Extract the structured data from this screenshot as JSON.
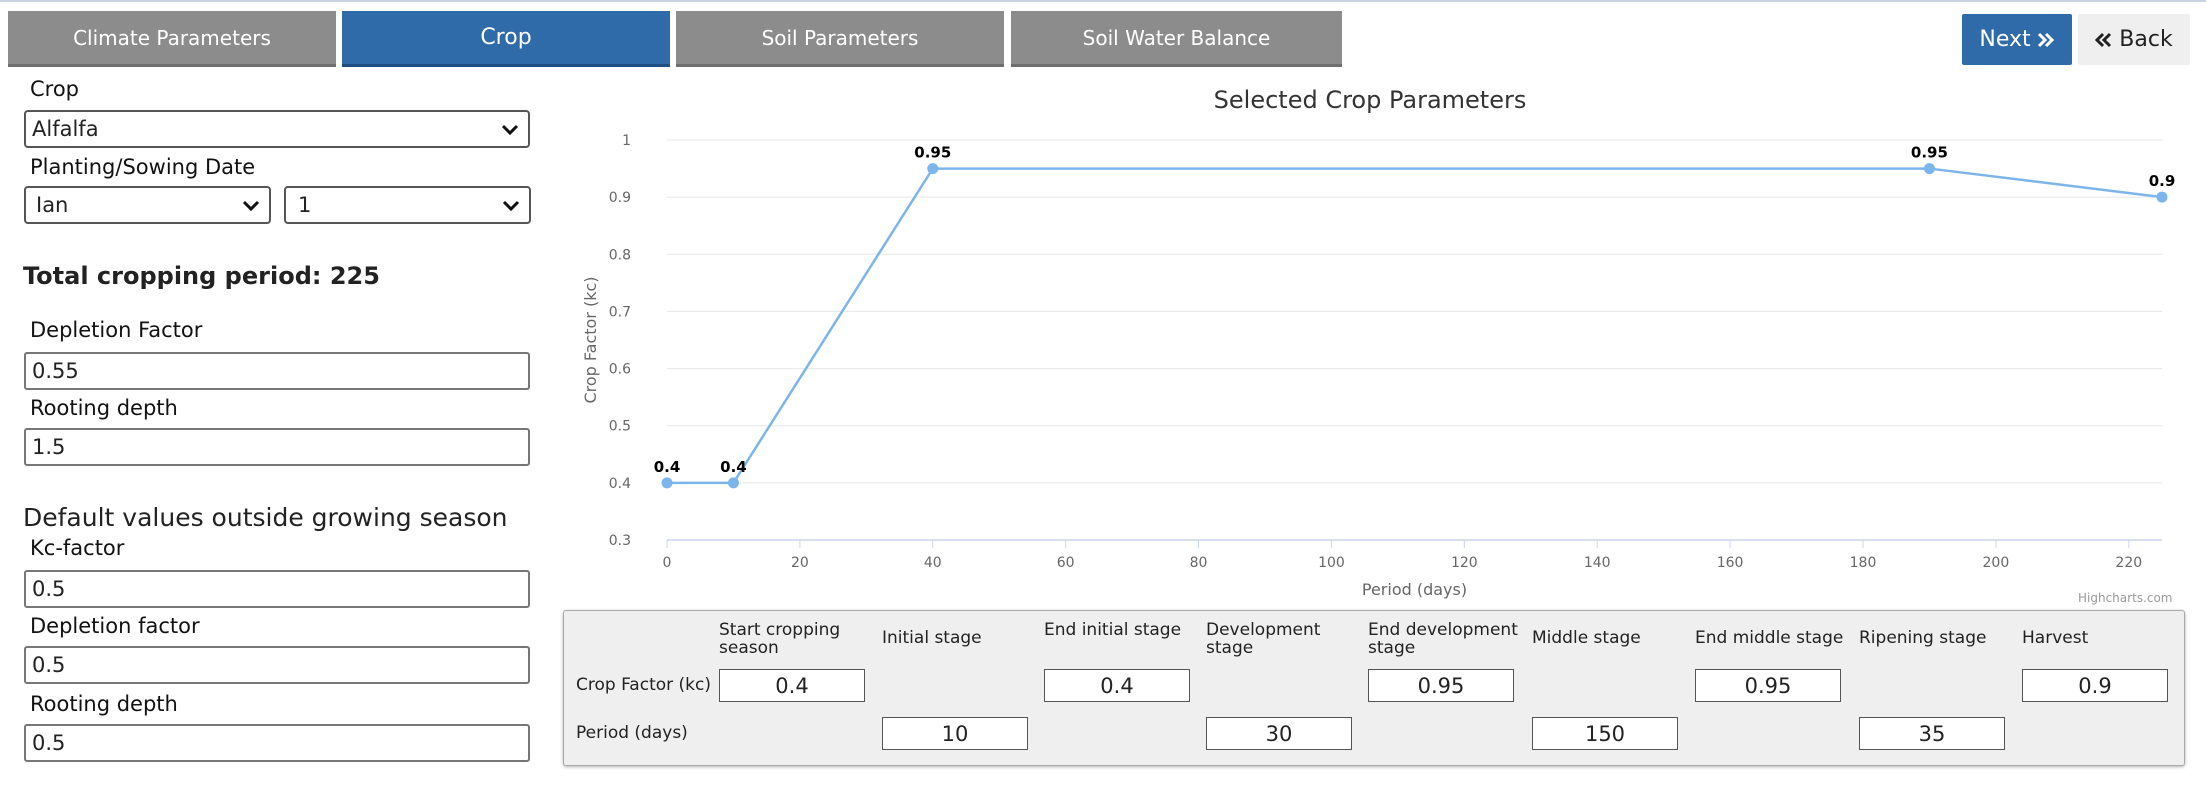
{
  "tabs": [
    {
      "label": "Climate Parameters",
      "active": false
    },
    {
      "label": "Crop",
      "active": true
    },
    {
      "label": "Soil Parameters",
      "active": false
    },
    {
      "label": "Soil Water Balance",
      "active": false
    }
  ],
  "nav": {
    "next_label": "Next",
    "next_icon": "double-chevron-right-icon",
    "back_label": "Back",
    "back_icon": "double-chevron-left-icon"
  },
  "form": {
    "crop_label": "Crop",
    "crop_value": "Alfalfa",
    "planting_label": "Planting/Sowing Date",
    "month_value": "Ian",
    "day_value": "1",
    "total_period_text": "Total cropping period: 225",
    "depletion_label": "Depletion Factor",
    "depletion_value": "0.55",
    "rooting_label": "Rooting depth",
    "rooting_value": "1.5",
    "defaults_heading": "Default values outside growing season",
    "kc_label": "Kc-factor",
    "kc_value": "0.5",
    "default_depletion_label": "Depletion factor",
    "default_depletion_value": "0.5",
    "default_rooting_label": "Rooting depth",
    "default_rooting_value": "0.5"
  },
  "chart_data": {
    "type": "line",
    "title": "Selected Crop Parameters",
    "xlabel": "Period (days)",
    "ylabel": "Crop Factor (kc)",
    "x": [
      0,
      10,
      40,
      190,
      225
    ],
    "series": [
      {
        "values": [
          0.4,
          0.4,
          0.95,
          0.95,
          0.9
        ]
      }
    ],
    "data_labels": [
      "0.4",
      "0.4",
      "0.95",
      "0.95",
      "0.9"
    ],
    "xlim": [
      0,
      225
    ],
    "ylim": [
      0.3,
      1
    ],
    "xticks": [
      "0",
      "20",
      "40",
      "60",
      "80",
      "100",
      "120",
      "140",
      "160",
      "180",
      "200",
      "220"
    ],
    "yticks": [
      "0.3",
      "0.4",
      "0.5",
      "0.6",
      "0.7",
      "0.8",
      "0.9",
      "1"
    ],
    "grid": true,
    "line_color": "#7cb5ec",
    "credits": "Highcharts.com"
  },
  "table": {
    "columns": [
      "Start cropping season",
      "Initial stage",
      "End initial stage",
      "Development stage",
      "End development stage",
      "Middle stage",
      "End middle stage",
      "Ripening stage",
      "Harvest"
    ],
    "rows": [
      {
        "label": "Crop Factor (kc)",
        "cells": [
          "0.4",
          "",
          "0.4",
          "",
          "0.95",
          "",
          "0.95",
          "",
          "0.9"
        ]
      },
      {
        "label": "Period (days)",
        "cells": [
          "",
          "10",
          "",
          "30",
          "",
          "150",
          "",
          "35",
          ""
        ]
      }
    ]
  },
  "colors": {
    "accent": "#2e6ba8",
    "tab_inactive": "#8c8c8c"
  }
}
